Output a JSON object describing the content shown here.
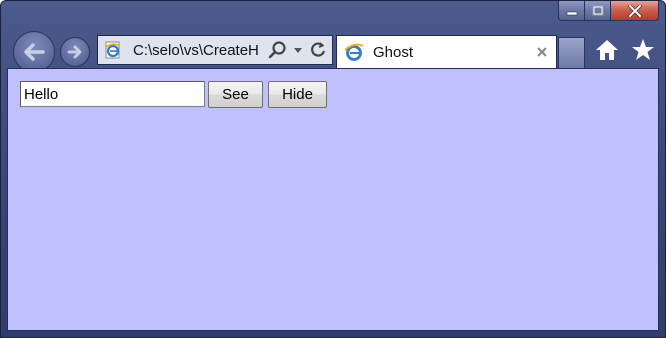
{
  "browser": {
    "address": "C:\\selo\\vs\\CreateH",
    "tab_title": "Ghost",
    "icons": {
      "back": "back-arrow-icon",
      "forward": "forward-arrow-icon",
      "page": "ie-logo-icon",
      "search": "search-icon",
      "dropdown": "chevron-down-icon",
      "refresh": "refresh-icon",
      "close_tab": "close-icon",
      "home": "home-icon",
      "favorites": "star-icon",
      "minimize": "minimize-icon",
      "maximize": "maximize-icon",
      "close_window": "close-icon"
    }
  },
  "page": {
    "background_color": "#c0c0ff",
    "text_input_value": "Hello",
    "see_label": "See",
    "hide_label": "Hide"
  }
}
